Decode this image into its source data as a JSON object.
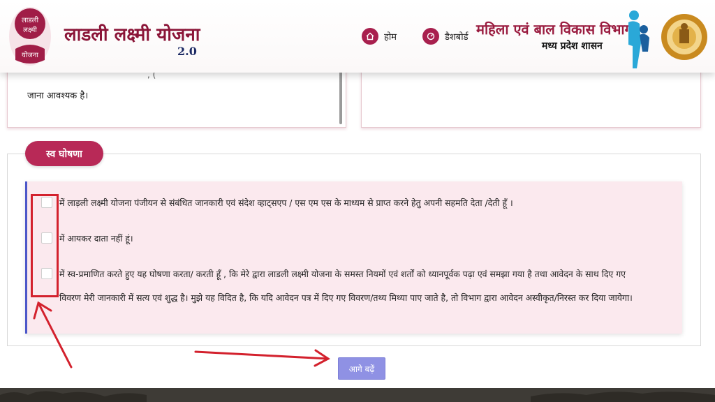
{
  "header": {
    "logo_text": [
      "लाडली",
      "लक्ष्मी",
      "योजना"
    ],
    "app_title": "लाडली लक्ष्मी योजना",
    "app_version": "2.0",
    "nav": [
      {
        "label": "होम",
        "icon": "home-icon"
      },
      {
        "label": "डैशबोर्ड",
        "icon": "dashboard-icon"
      }
    ],
    "dept_title": "महिला एवं बाल विकास विभाग",
    "dept_subtitle": "मध्य प्रदेश शासन"
  },
  "upper_panel": {
    "left_fragment": ", (",
    "left_text": "जाना आवश्यक है।"
  },
  "declaration": {
    "heading": "स्व घोषणा",
    "items": [
      {
        "lines": [
          "में लाड़ली लक्ष्मी योजना पंजीयन से संबंधित जानकारी एवं संदेश व्हाट्सएप / एस एम एस के माध्यम से प्राप्त करने हेतु अपनी सहमति देता /देती हूँ ।"
        ]
      },
      {
        "lines": [
          "में आयकर दाता नहीं हूं।"
        ]
      },
      {
        "lines": [
          "में स्व-प्रमाणित करते हुए यह घोषणा करता/ करती हूँ , कि मेरे द्वारा लाडली लक्ष्मी योजना के समस्त नियमों एवं शर्तों को ध्यानपूर्वक पढ़ा एवं समझा गया है तथा आवेदन के साथ दिए गए",
          "विवरण मेरी जानकारी में सत्य एवं शुद्ध है। मुझे यह विदित है, कि यदि आवेदन पत्र में दिए गए विवरण/तथ्य मिथ्या पाए जाते है, तो विभाग द्वारा आवेदन अस्वीकृत/निरस्त कर दिया जायेगा।"
        ]
      }
    ]
  },
  "next_button": "आगे बढ़ें",
  "colors": {
    "brand": "#b82957",
    "accent": "#4c57c9",
    "annotation": "#d3212d",
    "button": "#8f91e4"
  }
}
